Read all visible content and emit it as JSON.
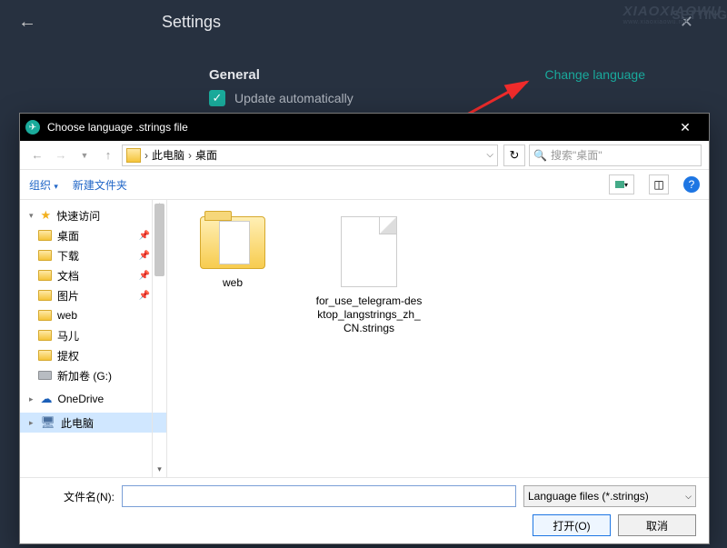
{
  "bg": {
    "title": "Settings",
    "section": "General",
    "change_lang": "Change language",
    "update_label": "Update automatically",
    "watermark": "XIAOXIAOWU",
    "watermark_sub": "www.xiaoxiaowu.me",
    "setting_text": "SETTING"
  },
  "dialog": {
    "title": "Choose language .strings file",
    "path_root": "此电脑",
    "path_leaf": "桌面",
    "search_placeholder": "搜索\"桌面\"",
    "toolbar": {
      "organize": "组织",
      "new_folder": "新建文件夹"
    },
    "sidebar": {
      "quick": "快速访问",
      "items": [
        {
          "label": "桌面",
          "pinned": true
        },
        {
          "label": "下载",
          "pinned": true
        },
        {
          "label": "文档",
          "pinned": true
        },
        {
          "label": "图片",
          "pinned": true
        },
        {
          "label": "web",
          "pinned": false
        },
        {
          "label": "马儿",
          "pinned": false
        },
        {
          "label": "提权",
          "pinned": false
        },
        {
          "label": "新加卷 (G:)",
          "pinned": false,
          "drive": true
        }
      ],
      "onedrive": "OneDrive",
      "thispc": "此电脑"
    },
    "content": [
      {
        "type": "folder",
        "label": "web"
      },
      {
        "type": "file",
        "label": "for_use_telegram-desktop_langstrings_zh_CN.strings"
      }
    ],
    "footer": {
      "filename_label": "文件名(N):",
      "filename_value": "",
      "filetype": "Language files (*.strings)",
      "open": "打开(O)",
      "cancel": "取消"
    }
  }
}
